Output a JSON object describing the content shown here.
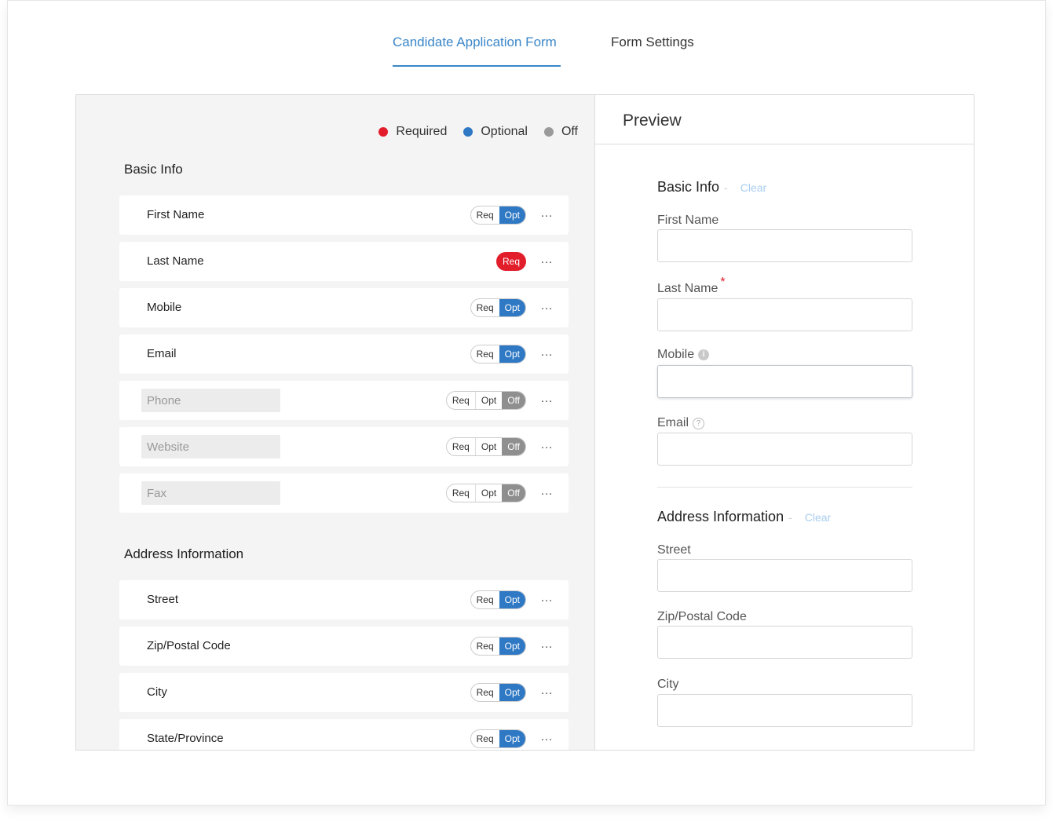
{
  "tabs": [
    {
      "label": "Candidate Application Form",
      "active": true
    },
    {
      "label": "Form Settings",
      "active": false
    }
  ],
  "legend": {
    "required": "Required",
    "optional": "Optional",
    "off": "Off"
  },
  "colors": {
    "accent": "#3a86c8",
    "required": "#e21e2b",
    "optional": "#2f78c4",
    "off": "#8f8f8f"
  },
  "toggle_labels": {
    "req": "Req",
    "opt": "Opt",
    "off": "Off"
  },
  "sections": {
    "basic": {
      "title": "Basic Info",
      "fields": [
        {
          "label": "First Name",
          "state": "Opt"
        },
        {
          "label": "Last Name",
          "state": "Req"
        },
        {
          "label": "Mobile",
          "state": "Opt"
        },
        {
          "label": "Email",
          "state": "Opt"
        },
        {
          "label": "Phone",
          "state": "Off"
        },
        {
          "label": "Website",
          "state": "Off"
        },
        {
          "label": "Fax",
          "state": "Off"
        }
      ]
    },
    "address": {
      "title": "Address Information",
      "fields": [
        {
          "label": "Street",
          "state": "Opt"
        },
        {
          "label": "Zip/Postal Code",
          "state": "Opt"
        },
        {
          "label": "City",
          "state": "Opt"
        },
        {
          "label": "State/Province",
          "state": "Opt"
        }
      ]
    }
  },
  "more_icon": "…",
  "preview": {
    "title": "Preview",
    "basic": {
      "title": "Basic Info",
      "dash": "-",
      "clear": "Clear",
      "fields": [
        {
          "label": "First Name"
        },
        {
          "label": "Last Name",
          "required_mark": "*"
        },
        {
          "label": "Mobile",
          "icon": "info-icon",
          "icon_glyph": "i"
        },
        {
          "label": "Email",
          "icon": "help-icon",
          "icon_glyph": "?"
        }
      ]
    },
    "address": {
      "title": "Address Information",
      "dash": "-",
      "clear": "Clear",
      "fields": [
        {
          "label": "Street"
        },
        {
          "label": "Zip/Postal Code"
        },
        {
          "label": "City"
        }
      ]
    }
  }
}
